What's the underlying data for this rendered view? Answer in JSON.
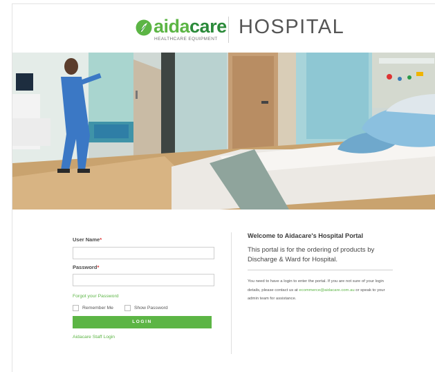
{
  "brand": {
    "logo_text_a": "aida",
    "logo_text_b": "care",
    "logo_tagline": "HEALTHCARE EQUIPMENT",
    "section": "HOSPITAL",
    "accent": "#5cb545"
  },
  "login": {
    "username_label": "User Name",
    "password_label": "Password",
    "required_marker": "*",
    "username_value": "",
    "password_value": "",
    "forgot_link": "Forgot your Password",
    "remember_label": "Remember Me",
    "show_password_label": "Show Password",
    "login_button": "LOGIN",
    "staff_link": "Aidacare Staff Login"
  },
  "welcome": {
    "title": "Welcome to Aidacare's Hospital Portal",
    "intro": "This portal is for the ordering of products by Discharge & Ward for Hospital.",
    "help_before": "You need to have a login to enter the portal. If you are not sure of your login details, please contact us at ",
    "help_email": "ecommerce@aidacare.com.au",
    "help_after": " or speak to your admin team for assistance."
  }
}
